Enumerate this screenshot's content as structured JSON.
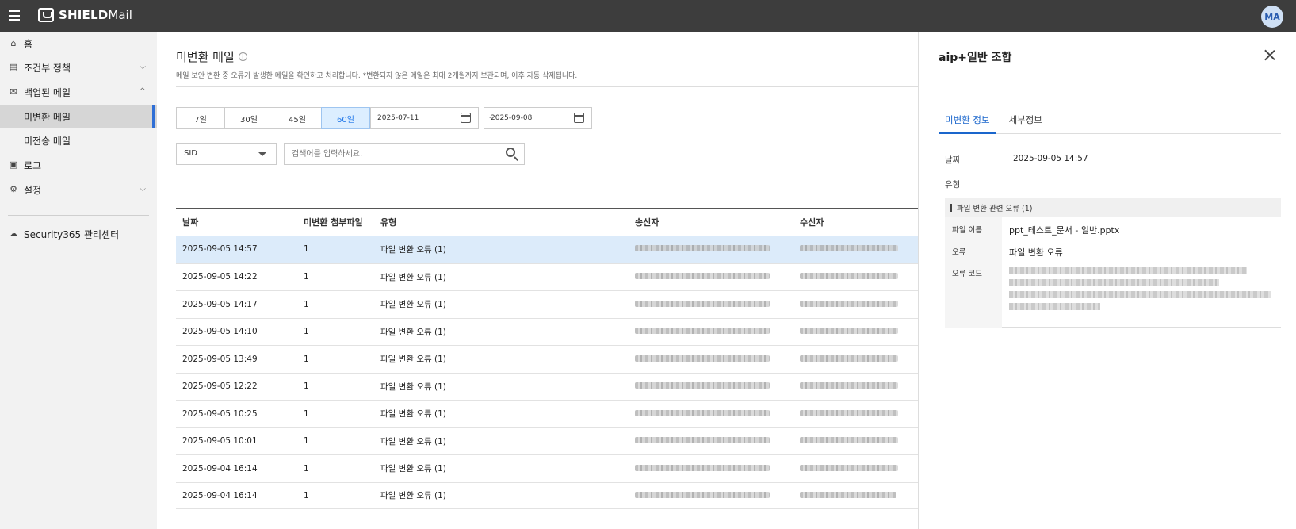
{
  "app": {
    "brand_strong": "SHIELD",
    "brand_light": "Mail",
    "avatar": "MA"
  },
  "sidebar": {
    "items": [
      {
        "label": "홈",
        "icon": "home-icon"
      },
      {
        "label": "조건부 정책",
        "icon": "policy-icon"
      },
      {
        "label": "백업된 메일",
        "icon": "mail-backup-icon"
      },
      {
        "label": "미변환 메일"
      },
      {
        "label": "미전송 메일"
      },
      {
        "label": "로그",
        "icon": "log-icon"
      },
      {
        "label": "설정",
        "icon": "gear-icon"
      },
      {
        "label": "Security365 관리센터",
        "icon": "cloud-icon"
      }
    ]
  },
  "main": {
    "title": "미변환 메일",
    "description": "메일 보안 변환 중 오류가 발생한 메일을 확인하고 처리합니다. *변환되지 않은 메일은 최대 2개월까지 보관되며, 이후 자동 삭제됩니다.",
    "ranges": [
      "7일",
      "30일",
      "45일",
      "60일"
    ],
    "active_range": "60일",
    "date_from": "2025-07-11",
    "date_sep": "-",
    "date_to": "2025-09-08",
    "sid": "SID",
    "search_placeholder": "검색어를 입력하세요."
  },
  "table": {
    "headers": [
      "날짜",
      "미변환 첨부파일",
      "유형",
      "송신자",
      "수신자"
    ],
    "rows": [
      {
        "date": "2025-09-05 14:57",
        "count": "1",
        "type": "파일 변환 오류 (1)"
      },
      {
        "date": "2025-09-05 14:22",
        "count": "1",
        "type": "파일 변환 오류 (1)"
      },
      {
        "date": "2025-09-05 14:17",
        "count": "1",
        "type": "파일 변환 오류 (1)"
      },
      {
        "date": "2025-09-05 14:10",
        "count": "1",
        "type": "파일 변환 오류 (1)"
      },
      {
        "date": "2025-09-05 13:49",
        "count": "1",
        "type": "파일 변환 오류 (1)"
      },
      {
        "date": "2025-09-05 12:22",
        "count": "1",
        "type": "파일 변환 오류 (1)"
      },
      {
        "date": "2025-09-05 10:25",
        "count": "1",
        "type": "파일 변환 오류 (1)"
      },
      {
        "date": "2025-09-05 10:01",
        "count": "1",
        "type": "파일 변환 오류 (1)"
      },
      {
        "date": "2025-09-04 16:14",
        "count": "1",
        "type": "파일 변환 오류 (1)"
      },
      {
        "date": "2025-09-04 16:14",
        "count": "1",
        "type": "파일 변환 오류 (1)"
      }
    ]
  },
  "panel": {
    "title": "aip+일반 조합",
    "tabs": [
      "미변환 정보",
      "세부정보"
    ],
    "date_label": "날짜",
    "date_value": "2025-09-05 14:57",
    "type_label": "유형",
    "error_group": "파일 변환 관련 오류 (1)",
    "file_name_label": "파일 이름",
    "file_name": "ppt_테스트_문서 - 일반.pptx",
    "error_label": "오류",
    "error_value": "파일 변환 오류",
    "error_code_label": "오류 코드"
  },
  "colors": {
    "accent": "#1a66cc",
    "selected_row": "#dcebfa",
    "topbar": "#3d3d3d"
  }
}
